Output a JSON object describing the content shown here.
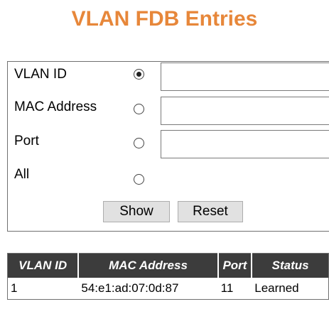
{
  "page": {
    "title": "VLAN FDB Entries"
  },
  "form": {
    "rows": [
      {
        "label": "VLAN ID",
        "selected": true,
        "value": ""
      },
      {
        "label": "MAC Address",
        "selected": false,
        "value": ""
      },
      {
        "label": "Port",
        "selected": false,
        "value": ""
      },
      {
        "label": "All",
        "selected": false
      }
    ],
    "show_label": "Show",
    "reset_label": "Reset"
  },
  "table": {
    "headers": [
      "VLAN ID",
      "MAC Address",
      "Port",
      "Status"
    ],
    "rows": [
      [
        "1",
        "54:e1:ad:07:0d:87",
        "11",
        "Learned"
      ]
    ]
  },
  "colors": {
    "title": "#e7873a",
    "table_header_bg": "#3c3c3c",
    "table_header_text": "#ffffff"
  }
}
